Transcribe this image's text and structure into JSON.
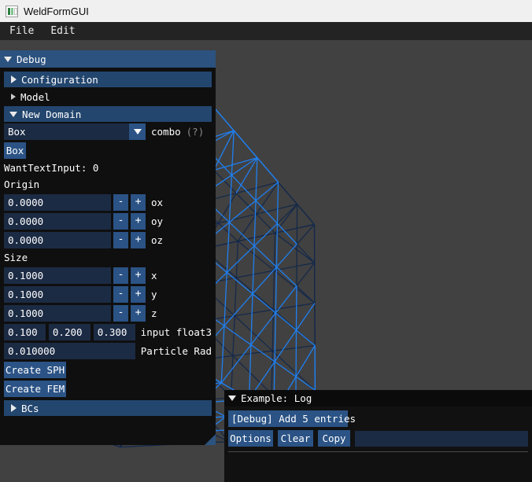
{
  "window": {
    "title": "WeldFormGUI",
    "icon": "app-window-icon"
  },
  "menubar": {
    "items": [
      {
        "label": "File"
      },
      {
        "label": "Edit"
      }
    ]
  },
  "debug_window": {
    "title": "Debug",
    "collapse_icon": "triangle-down-icon",
    "sections": [
      {
        "label": "Configuration",
        "icon": "triangle-right-icon",
        "expanded": false,
        "highlighted": true
      },
      {
        "label": "Model",
        "icon": "triangle-right-icon",
        "expanded": false,
        "highlighted": false
      },
      {
        "label": "New Domain",
        "icon": "triangle-down-icon",
        "expanded": true,
        "highlighted": true
      }
    ],
    "combo": {
      "value": "Box",
      "label": "combo",
      "help_marker": "(?)",
      "arrow_icon": "triangle-down-icon"
    },
    "shape_button": "Box",
    "want_text_input": "WantTextInput: 0",
    "origin_group_label": "Origin",
    "origin_fields": [
      {
        "value": "0.0000",
        "label": "ox",
        "minus": "-",
        "plus": "+"
      },
      {
        "value": "0.0000",
        "label": "oy",
        "minus": "-",
        "plus": "+"
      },
      {
        "value": "0.0000",
        "label": "oz",
        "minus": "-",
        "plus": "+"
      }
    ],
    "size_group_label": "Size",
    "size_fields": [
      {
        "value": "0.1000",
        "label": "x",
        "minus": "-",
        "plus": "+"
      },
      {
        "value": "0.1000",
        "label": "y",
        "minus": "-",
        "plus": "+"
      },
      {
        "value": "0.1000",
        "label": "z",
        "minus": "-",
        "plus": "+"
      }
    ],
    "float3": {
      "values": [
        "0.100",
        "0.200",
        "0.300"
      ],
      "label": "input float3"
    },
    "particle_radius": {
      "value": "0.010000",
      "label": "Particle Rad"
    },
    "actions": [
      {
        "label": "Create SPH"
      },
      {
        "label": "Create FEM"
      }
    ],
    "bcs_section": {
      "label": "BCs",
      "icon": "triangle-right-icon",
      "expanded": false
    },
    "resize_grip": "resize-grip-icon"
  },
  "log_window": {
    "title": "Example: Log",
    "collapse_icon": "triangle-down-icon",
    "add_entries_button": "[Debug] Add 5 entries",
    "buttons": [
      {
        "label": "Options"
      },
      {
        "label": "Clear"
      },
      {
        "label": "Copy"
      }
    ],
    "filter_value": "",
    "filter_placeholder": "",
    "entries": []
  },
  "viewport": {
    "background": "#414141",
    "mesh_color_front": "#1f7ff0",
    "mesh_color_back": "#15294a",
    "mesh_name": "box-wireframe-mesh",
    "grid_divisions": 5
  },
  "colors": {
    "accent": "#2c527f",
    "button": "#2b5385",
    "input_bg": "#1c2b44",
    "header_active": "#23466e",
    "panel_bg": "#0f0f0f",
    "titlebar_bg": "#f0f0f0",
    "menubar_bg": "#232323"
  }
}
